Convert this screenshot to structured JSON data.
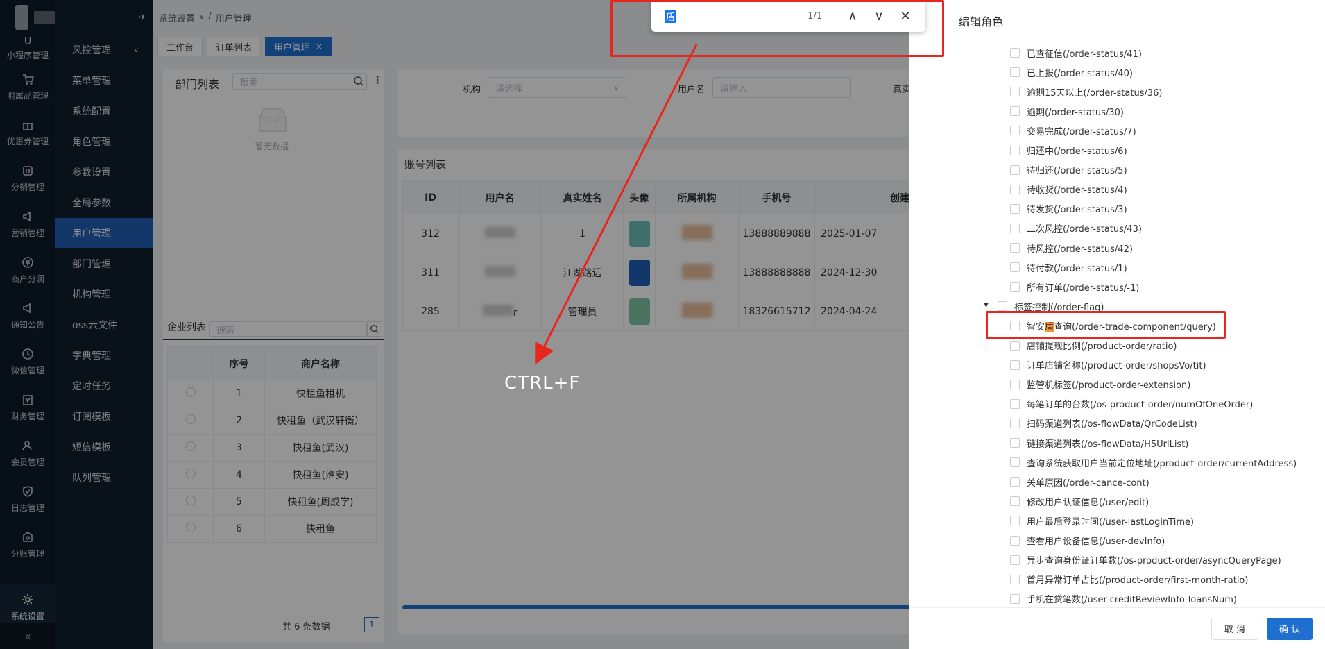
{
  "sidebar": {
    "items": [
      {
        "label": "小程序管理",
        "icon": "mini-program-icon"
      },
      {
        "label": "附属品管理",
        "icon": "cart-icon"
      },
      {
        "label": "优惠券管理",
        "icon": "gift-icon"
      },
      {
        "label": "分销管理",
        "icon": "distribution-icon"
      },
      {
        "label": "营销管理",
        "icon": "megaphone-icon"
      },
      {
        "label": "商户分润",
        "icon": "yen-icon"
      },
      {
        "label": "通知公告",
        "icon": "notice-icon"
      },
      {
        "label": "微信管理",
        "icon": "wechat-icon"
      },
      {
        "label": "财务管理",
        "icon": "finance-icon"
      },
      {
        "label": "会员管理",
        "icon": "member-icon"
      },
      {
        "label": "日志管理",
        "icon": "shield-icon"
      },
      {
        "label": "分账管理",
        "icon": "split-icon"
      },
      {
        "label": "系统设置",
        "icon": "gear-icon"
      }
    ],
    "collapse": "«"
  },
  "submenu": {
    "items": [
      "风控管理",
      "菜单管理",
      "系统配置",
      "角色管理",
      "参数设置",
      "全局参数",
      "用户管理",
      "部门管理",
      "机构管理",
      "oss云文件",
      "字典管理",
      "定时任务",
      "订阅模板",
      "短信模板",
      "队列管理"
    ]
  },
  "breadcrumb": {
    "parent": "系统设置",
    "current": "用户管理",
    "sep": "/",
    "chevron": "∨"
  },
  "tabs": [
    {
      "label": "工作台"
    },
    {
      "label": "订单列表"
    },
    {
      "label": "用户管理",
      "close": "×"
    }
  ],
  "dept": {
    "title": "部门列表",
    "search_placeholder": "搜索",
    "empty": "暂无数据"
  },
  "company": {
    "title": "企业列表",
    "search_placeholder": "搜索",
    "headers": [
      "序号",
      "商户名称"
    ],
    "rows": [
      {
        "no": "1",
        "name": "快租鱼租机"
      },
      {
        "no": "2",
        "name": "快租鱼（武汉轩衡）"
      },
      {
        "no": "3",
        "name": "快租鱼(武汉)"
      },
      {
        "no": "4",
        "name": "快租鱼(淮安)"
      },
      {
        "no": "5",
        "name": "快租鱼(周成学)"
      },
      {
        "no": "6",
        "name": "快租鱼"
      }
    ],
    "total": "共 6 条数据",
    "page": "1"
  },
  "filter": {
    "org_label": "机构",
    "org_placeholder": "请选择",
    "user_label": "用户名",
    "user_placeholder": "请输入",
    "real_label": "真实"
  },
  "accounts": {
    "title": "账号列表",
    "headers": [
      "ID",
      "用户名",
      "真实姓名",
      "头像",
      "所属机构",
      "手机号",
      "创建时"
    ],
    "rows": [
      {
        "id": "312",
        "username": "",
        "real": "1",
        "phone": "13888889888",
        "created": "2025-01-07"
      },
      {
        "id": "311",
        "username": "",
        "real": "江湖路远",
        "phone": "13888888888",
        "created": "2024-12-30"
      },
      {
        "id": "285",
        "username": "r",
        "real": "管理员",
        "phone": "18326615712",
        "created": "2024-04-24"
      }
    ]
  },
  "findbar": {
    "query": "盾",
    "count": "1/1",
    "prev": "∧",
    "next": "∨",
    "close": "✕"
  },
  "annotation": {
    "text": "CTRL+F"
  },
  "drawer": {
    "title": "编辑角色",
    "items": [
      {
        "label": "已查征信(/order-status/41)",
        "level": 2
      },
      {
        "label": "已上报(/order-status/40)",
        "level": 2
      },
      {
        "label": "逾期15天以上(/order-status/36)",
        "level": 2
      },
      {
        "label": "逾期(/order-status/30)",
        "level": 2
      },
      {
        "label": "交易完成(/order-status/7)",
        "level": 2
      },
      {
        "label": "归还中(/order-status/6)",
        "level": 2
      },
      {
        "label": "待归还(/order-status/5)",
        "level": 2
      },
      {
        "label": "待收货(/order-status/4)",
        "level": 2
      },
      {
        "label": "待发货(/order-status/3)",
        "level": 2
      },
      {
        "label": "二次风控(/order-status/43)",
        "level": 2
      },
      {
        "label": "待风控(/order-status/42)",
        "level": 2
      },
      {
        "label": "待付款(/order-status/1)",
        "level": 2
      },
      {
        "label": "所有订单(/order-status/-1)",
        "level": 2
      },
      {
        "label": "标签控制(/order-flag)",
        "level": 1
      },
      {
        "label_pre": "智安",
        "label_mark": "盾",
        "label_post": "查询(/order-trade-component/query)",
        "level": 2
      },
      {
        "label": "店铺提现比例(/product-order/ratio)",
        "level": 2
      },
      {
        "label": "订单店铺名称(/product-order/shopsVo/tit)",
        "level": 2
      },
      {
        "label": "监管机标签(/product-order-extension)",
        "level": 2
      },
      {
        "label": "每笔订单的台数(/os-product-order/numOfOneOrder)",
        "level": 2
      },
      {
        "label": "扫码渠道列表(/os-flowData/QrCodeList)",
        "level": 2
      },
      {
        "label": "链接渠道列表(/os-flowData/H5UrlList)",
        "level": 2
      },
      {
        "label": "查询系统获取用户当前定位地址(/product-order/currentAddress)",
        "level": 2
      },
      {
        "label": "关单原因(/order-cance-cont)",
        "level": 2
      },
      {
        "label": "修改用户认证信息(/user/edit)",
        "level": 2
      },
      {
        "label": "用户最后登录时间(/user-lastLoginTime)",
        "level": 2
      },
      {
        "label": "查看用户设备信息(/user-devInfo)",
        "level": 2
      },
      {
        "label": "异步查询身份证订单数(/os-product-order/asyncQueryPage)",
        "level": 2
      },
      {
        "label": "首月异常订单占比(/product-order/first-month-ratio)",
        "level": 2
      },
      {
        "label": "手机在贷笔数(/user-creditReviewInfo-loansNum)",
        "level": 2
      }
    ],
    "cancel": "取 消",
    "confirm": "确 认"
  },
  "colors": {
    "accent": "#1f6fd1",
    "highlight_box": "#e8261d",
    "search_match": "#ff9632",
    "sidebar_bg": "#0d1b2a"
  }
}
